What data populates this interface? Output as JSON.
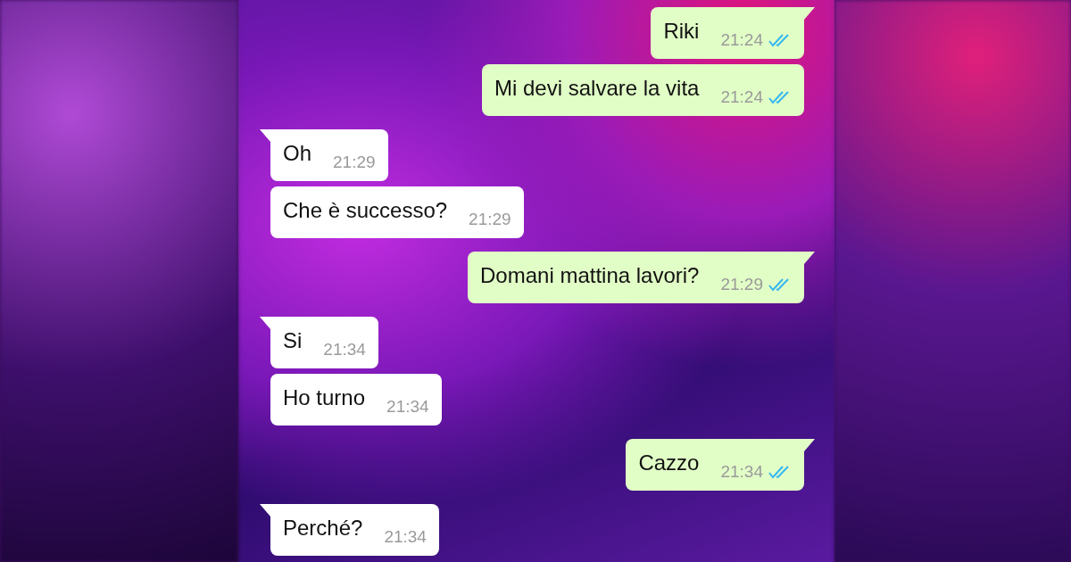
{
  "messages": [
    {
      "kind": "sent",
      "text": "Riki",
      "time": "21:24",
      "read": true,
      "tail": true
    },
    {
      "kind": "sent",
      "text": "Mi devi salvare la vita",
      "time": "21:24",
      "read": true,
      "tail": false
    },
    {
      "kind": "received",
      "text": "Oh",
      "time": "21:29",
      "tail": true
    },
    {
      "kind": "received",
      "text": "Che è successo?",
      "time": "21:29",
      "tail": false
    },
    {
      "kind": "sent",
      "text": "Domani mattina lavori?",
      "time": "21:29",
      "read": true,
      "tail": true
    },
    {
      "kind": "received",
      "text": "Si",
      "time": "21:34",
      "tail": true
    },
    {
      "kind": "received",
      "text": "Ho turno",
      "time": "21:34",
      "tail": false
    },
    {
      "kind": "sent",
      "text": "Cazzo",
      "time": "21:34",
      "read": true,
      "tail": true
    },
    {
      "kind": "received",
      "text": "Perché?",
      "time": "21:34",
      "tail": true
    }
  ]
}
